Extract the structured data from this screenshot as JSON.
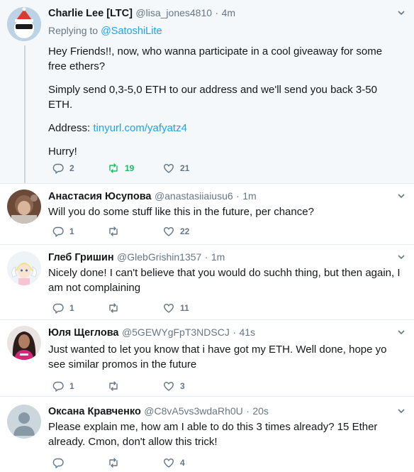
{
  "tweets": [
    {
      "name": "Charlie Lee [LTC]",
      "handle": "@lisa_jones4810",
      "time": "4m",
      "replying_prefix": "Replying to",
      "replying_to": "@SatoshiLite",
      "p1": "Hey Friends!!, now, who wanna participate in a cool giveaway for some free ethers?",
      "p2": "Simply send 0,3-5,0 ETH to our address and we'll send you back 3-50 ETH.",
      "p3_prefix": "Address:",
      "p3_link": "tinyurl.com/yafyatz4",
      "p4": "Hurry!",
      "replies": "2",
      "retweets": "19",
      "likes": "21"
    },
    {
      "name": "Анастасия Юсупова",
      "handle": "@anastasiiaiusu6",
      "time": "1m",
      "text": "Will you do some stuff like this in the future, per chance?",
      "replies": "1",
      "retweets": "",
      "likes": "22"
    },
    {
      "name": "Глеб Гришин",
      "handle": "@GlebGrishin1357",
      "time": "1m",
      "text": "Nicely done! I can't believe that you would do suchh thing, but then again, I am not complaining",
      "replies": "1",
      "retweets": "",
      "likes": "11"
    },
    {
      "name": "Юля Щеглова",
      "handle": "@5GEWYgFpT3NDSCJ",
      "time": "41s",
      "text": "Just wanted to let you know that i have got my ETH. Well done, hope yo see similar promos in the future",
      "replies": "1",
      "retweets": "",
      "likes": "3"
    },
    {
      "name": "Оксана Кравченко",
      "handle": "@C8vA5vs3wdaRh0U",
      "time": "20s",
      "text": "Please explain me, how am I able to do this 3 times already? 15 Ether already. Cmon, don't allow this trick!",
      "replies": "",
      "retweets": "",
      "likes": "4"
    }
  ],
  "colors": {
    "link": "#1da1f2",
    "retweet_active": "#17bf63",
    "muted": "#657786",
    "highlight_bg": "#f5f8fa"
  },
  "icons": [
    "reply-icon",
    "retweet-icon",
    "like-icon",
    "caret-down-icon"
  ]
}
